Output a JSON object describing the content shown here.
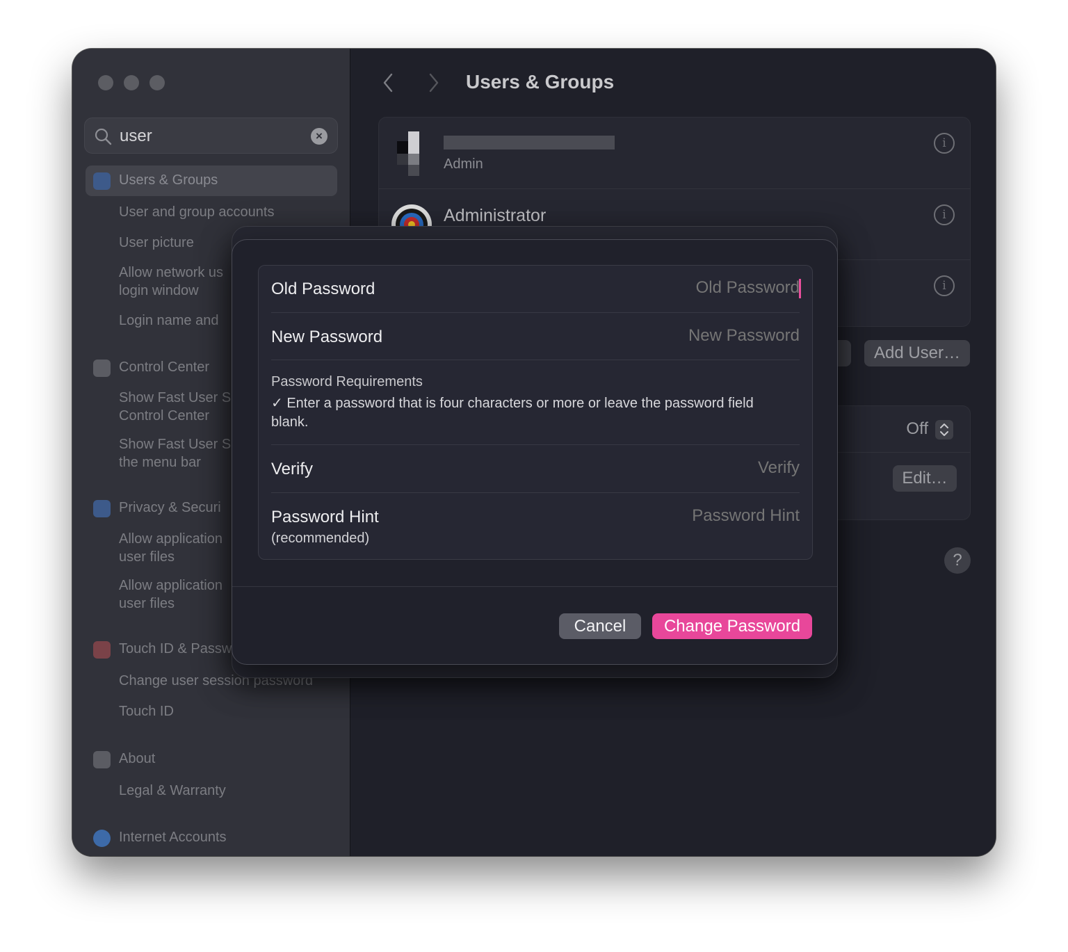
{
  "sidebar": {
    "search": {
      "value": "user"
    },
    "items": [
      {
        "label": "Users & Groups"
      },
      {
        "label": "User and group accounts"
      },
      {
        "label": "User picture"
      },
      {
        "label": "Allow network us\nlogin window"
      },
      {
        "label": "Login name and"
      },
      {
        "label": "Control Center"
      },
      {
        "label": "Show Fast User S\nControl Center"
      },
      {
        "label": "Show Fast User S\nthe menu bar"
      },
      {
        "label": "Privacy & Securi"
      },
      {
        "label": "Allow application\nuser files"
      },
      {
        "label": "Allow application\nuser files"
      },
      {
        "label": "Touch ID & Passw"
      },
      {
        "label": "Change user session password"
      },
      {
        "label": "Touch ID"
      },
      {
        "label": "About"
      },
      {
        "label": "Legal & Warranty"
      },
      {
        "label": "Internet Accounts"
      }
    ]
  },
  "main": {
    "title": "Users & Groups",
    "users": [
      {
        "role": "Admin"
      },
      {
        "name": "Administrator"
      }
    ],
    "add_user_label": "Add User…",
    "off_value": "Off",
    "edit_label": "Edit…",
    "help_label": "?"
  },
  "dialog": {
    "old_password": {
      "label": "Old Password",
      "placeholder": "Old Password"
    },
    "new_password": {
      "label": "New Password",
      "placeholder": "New Password"
    },
    "requirements": {
      "title": "Password Requirements",
      "text": "✓ Enter a password that is four characters or more or leave the password field blank."
    },
    "verify": {
      "label": "Verify",
      "placeholder": "Verify"
    },
    "hint": {
      "label": "Password Hint",
      "sublabel": "(recommended)",
      "placeholder": "Password Hint"
    },
    "cancel_label": "Cancel",
    "change_label": "Change Password"
  },
  "colors": {
    "accent": "#e8479a"
  }
}
